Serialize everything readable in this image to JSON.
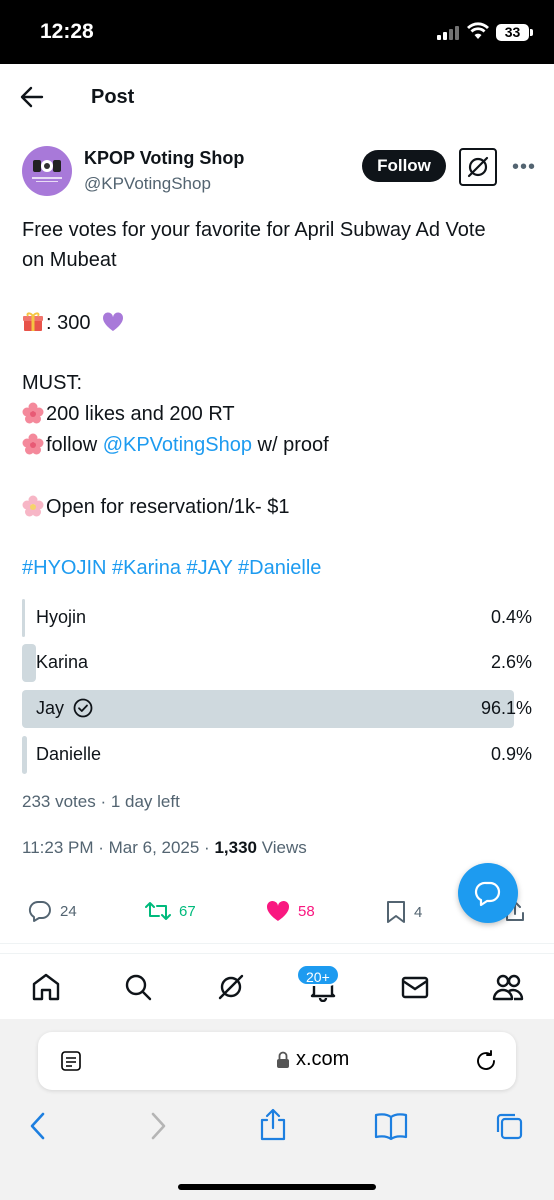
{
  "status_bar": {
    "time": "12:28",
    "battery": "33"
  },
  "header": {
    "title": "Post"
  },
  "author": {
    "name": "KPOP Voting Shop",
    "handle": "@KPVotingShop",
    "follow_label": "Follow"
  },
  "tweet": {
    "line1": "Free votes for your favorite for April Subway Ad Vote",
    "line2": "on Mubeat",
    "prize": ": 300",
    "must": "MUST:",
    "req1": "200 likes and 200 RT",
    "req2_prefix": "follow ",
    "req2_mention": "@KPVotingShop",
    "req2_suffix": " w/ proof",
    "reservation": "Open for reservation/1k- $1",
    "hashtags": "#HYOJIN #Karina #JAY #Danielle"
  },
  "poll": {
    "options": [
      {
        "label": "Hyojin",
        "percent": "0.4%",
        "value": 0.4
      },
      {
        "label": "Karina",
        "percent": "2.6%",
        "value": 2.6
      },
      {
        "label": "Jay",
        "percent": "96.1%",
        "value": 96.1,
        "selected": true
      },
      {
        "label": "Danielle",
        "percent": "0.9%",
        "value": 0.9
      }
    ],
    "meta": "233 votes · 1 day left"
  },
  "timestamp": {
    "date": "11:23 PM · Mar 6, 2025 · ",
    "views": "1,330",
    "views_label": " Views"
  },
  "engagement": {
    "replies": "24",
    "reposts": "67",
    "likes": "58",
    "bookmarks": "4"
  },
  "nav": {
    "notifications_badge": "20+"
  },
  "browser": {
    "url": "x.com"
  },
  "colors": {
    "accent": "#1d9bf0",
    "repost": "#00ba7c",
    "like": "#f91880",
    "avatar": "#a879d9"
  },
  "icons": [
    "back-arrow-icon",
    "grok-icon",
    "more-icon",
    "gift-icon",
    "heart-icon",
    "flower-icon",
    "check-circle-icon",
    "reply-icon",
    "repost-icon",
    "like-icon",
    "bookmark-icon",
    "share-icon",
    "message-icon",
    "home-icon",
    "search-icon",
    "bell-icon",
    "mail-icon",
    "people-icon",
    "reader-icon",
    "lock-icon",
    "reload-icon",
    "chevron-left-icon",
    "chevron-right-icon",
    "book-icon",
    "tabs-icon"
  ]
}
